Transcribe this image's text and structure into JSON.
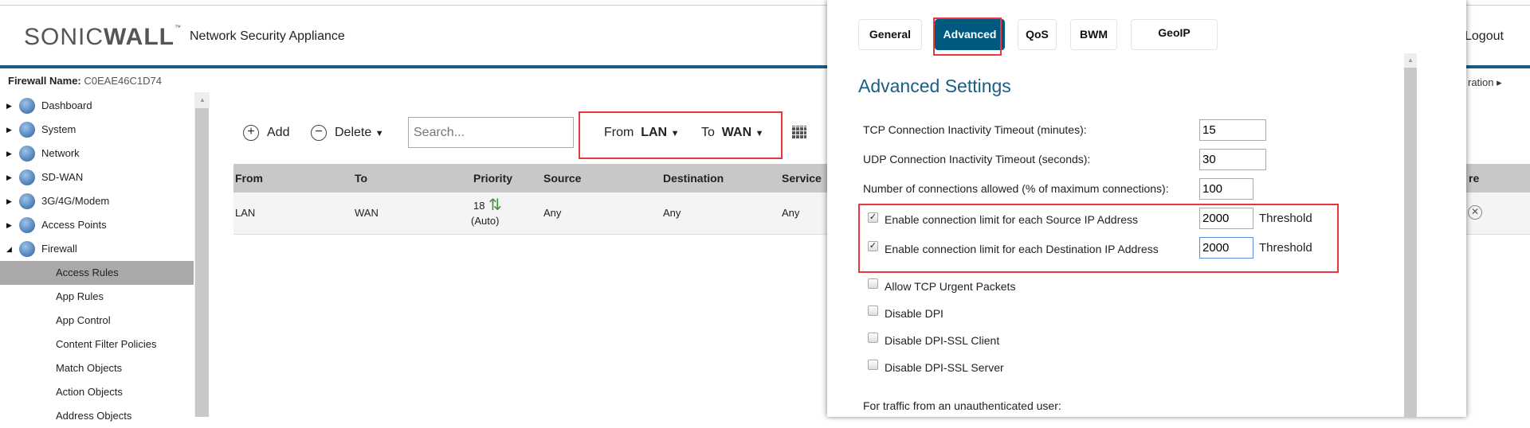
{
  "header": {
    "brand": "SONICWALL",
    "product": "Network Security Appliance",
    "logout": "Logout",
    "breadcrumb_tail": "ration"
  },
  "firewall": {
    "label": "Firewall Name:",
    "value": "C0EAE46C1D74"
  },
  "sidebar": {
    "items": [
      {
        "label": "Dashboard",
        "icon": "dashboard-icon"
      },
      {
        "label": "System",
        "icon": "system-icon"
      },
      {
        "label": "Network",
        "icon": "network-icon"
      },
      {
        "label": "SD-WAN",
        "icon": "sdwan-icon"
      },
      {
        "label": "3G/4G/Modem",
        "icon": "modem-icon"
      },
      {
        "label": "Access Points",
        "icon": "access-points-icon"
      },
      {
        "label": "Firewall",
        "icon": "firewall-icon",
        "expanded": true
      }
    ],
    "subitems": [
      {
        "label": "Access Rules",
        "selected": true
      },
      {
        "label": "App Rules"
      },
      {
        "label": "App Control"
      },
      {
        "label": "Content Filter Policies"
      },
      {
        "label": "Match Objects"
      },
      {
        "label": "Action Objects"
      },
      {
        "label": "Address Objects"
      }
    ]
  },
  "toolbar": {
    "add": "Add",
    "delete": "Delete",
    "search_placeholder": "Search...",
    "from_label": "From",
    "from_value": "LAN",
    "to_label": "To",
    "to_value": "WAN"
  },
  "table": {
    "columns": [
      "From",
      "To",
      "Priority",
      "Source",
      "Destination",
      "Service",
      "re"
    ],
    "rows": [
      {
        "from": "LAN",
        "to": "WAN",
        "priority": "18",
        "priority_note": "(Auto)",
        "source": "Any",
        "destination": "Any",
        "service": "Any"
      }
    ]
  },
  "modal": {
    "tabs": [
      {
        "label": "General"
      },
      {
        "label": "Advanced",
        "active": true
      },
      {
        "label": "QoS"
      },
      {
        "label": "BWM"
      },
      {
        "label": "GeoIP"
      }
    ],
    "title": "Advanced Settings",
    "fields": [
      {
        "label": "TCP Connection Inactivity Timeout (minutes):",
        "value": "15"
      },
      {
        "label": "UDP Connection Inactivity Timeout (seconds):",
        "value": "30"
      },
      {
        "label": "Number of connections allowed (% of maximum connections):",
        "value": "100"
      }
    ],
    "limits": [
      {
        "label": "Enable connection limit for each Source IP Address",
        "checked": true,
        "value": "2000",
        "suffix": "Threshold"
      },
      {
        "label": "Enable connection limit for each Destination IP Address",
        "checked": true,
        "value": "2000",
        "suffix": "Threshold"
      }
    ],
    "checkboxes": [
      {
        "label": "Allow TCP Urgent Packets",
        "checked": false
      },
      {
        "label": "Disable DPI",
        "checked": false
      },
      {
        "label": "Disable DPI-SSL Client",
        "checked": false
      },
      {
        "label": "Disable DPI-SSL Server",
        "checked": false
      }
    ],
    "footer_label": "For traffic from an unauthenticated user:"
  },
  "colors": {
    "accent": "#005a80",
    "header_line": "#1b5d82",
    "highlight": "#e8373c",
    "title": "#1a5e85"
  }
}
